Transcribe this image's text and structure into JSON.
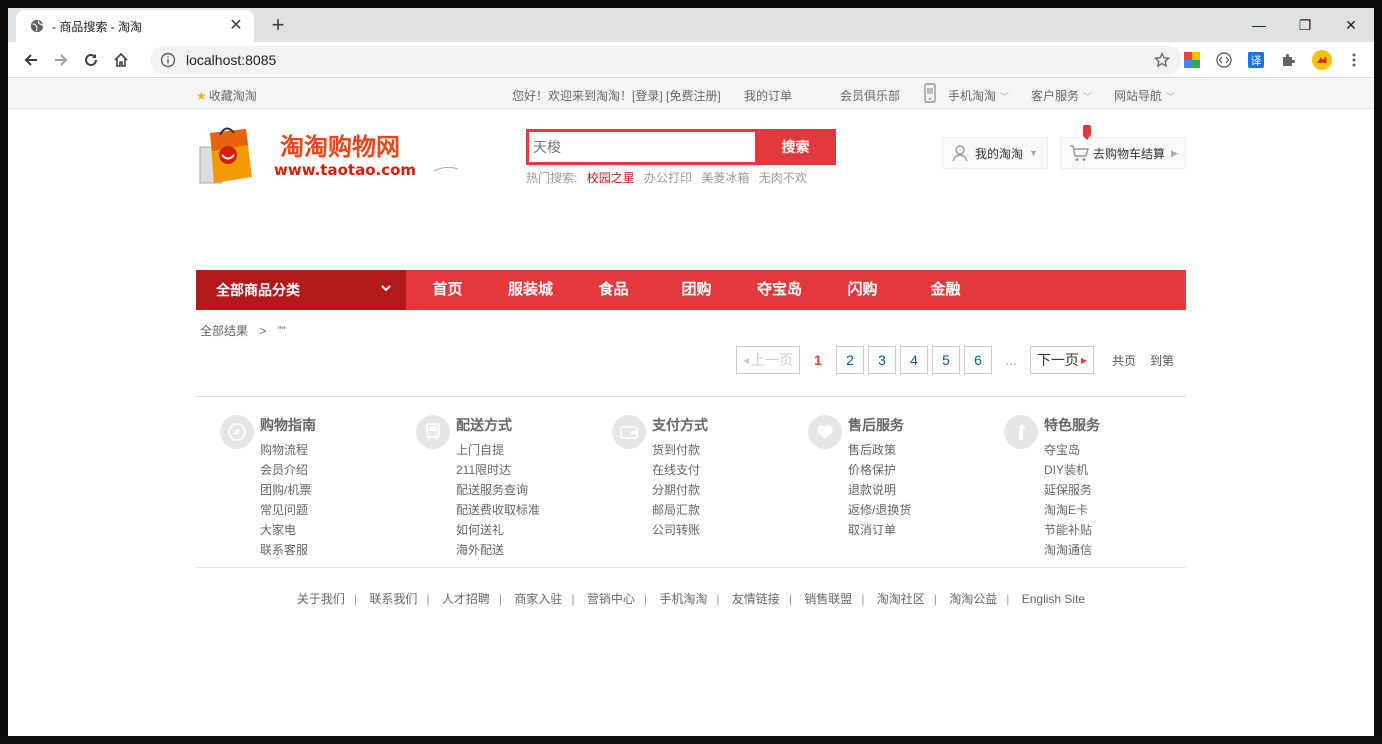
{
  "browser": {
    "tab_title": "- 商品搜索 - 淘淘",
    "tab_close": "✕",
    "new_tab": "+",
    "url": "localhost:8085",
    "win_min": "—",
    "win_max": "❐",
    "win_close": "✕"
  },
  "topbar": {
    "favorite": "收藏淘淘",
    "welcome": "您好！欢迎来到淘淘！[登录] [免费注册]",
    "my_orders": "我的订单",
    "member_club": "会员俱乐部",
    "mobile": "手机淘淘",
    "customer_service": "客户服务",
    "site_nav": "网站导航",
    "dropdown_arrow": "﹀"
  },
  "header": {
    "logo_title": "淘淘购物网",
    "logo_url": "www.taotao.com",
    "search_placeholder": "天梭",
    "search_button": "搜索",
    "hot_label": "热门搜索:",
    "hot_items": [
      "校园之星",
      "办公打印",
      "美菱冰箱",
      "无肉不欢"
    ],
    "my_taotao": "我的淘淘",
    "cart": "去购物车结算"
  },
  "nav": {
    "all_categories": "全部商品分类",
    "items": [
      "首页",
      "服装城",
      "食品",
      "团购",
      "夺宝岛",
      "闪购",
      "金融"
    ]
  },
  "crumb": {
    "root": "全部结果",
    "sep": ">",
    "query": "””"
  },
  "pager": {
    "prev": "上一页",
    "current": "1",
    "pages": [
      "2",
      "3",
      "4",
      "5",
      "6"
    ],
    "dots": "...",
    "next": "下一页",
    "total": "共页",
    "goto": "到第"
  },
  "guide": [
    {
      "title": "购物指南",
      "icon": "compass-icon",
      "items": [
        "购物流程",
        "会员介绍",
        "团购/机票",
        "常见问题",
        "大家电",
        "联系客服"
      ]
    },
    {
      "title": "配送方式",
      "icon": "bus-icon",
      "items": [
        "上门自提",
        "211限时达",
        "配送服务查询",
        "配送费收取标准",
        "如何送礼",
        "海外配送"
      ]
    },
    {
      "title": "支付方式",
      "icon": "wallet-icon",
      "items": [
        "货到付款",
        "在线支付",
        "分期付款",
        "邮局汇款",
        "公司转账"
      ]
    },
    {
      "title": "售后服务",
      "icon": "heart-icon",
      "items": [
        "售后政策",
        "价格保护",
        "退款说明",
        "返修/退换货",
        "取消订单"
      ]
    },
    {
      "title": "特色服务",
      "icon": "wrench-icon",
      "items": [
        "夺宝岛",
        "DIY装机",
        "延保服务",
        "淘淘E卡",
        "节能补贴",
        "淘淘通信"
      ]
    }
  ],
  "footer_links": [
    "关于我们",
    "联系我们",
    "人才招聘",
    "商家入驻",
    "营销中心",
    "手机淘淘",
    "友情链接",
    "销售联盟",
    "淘淘社区",
    "淘淘公益",
    "English Site"
  ],
  "footer_sep": "|",
  "colors": {
    "brand_red": "#e4393c",
    "dark_red": "#b1191a",
    "hot_red": "#c81623"
  }
}
